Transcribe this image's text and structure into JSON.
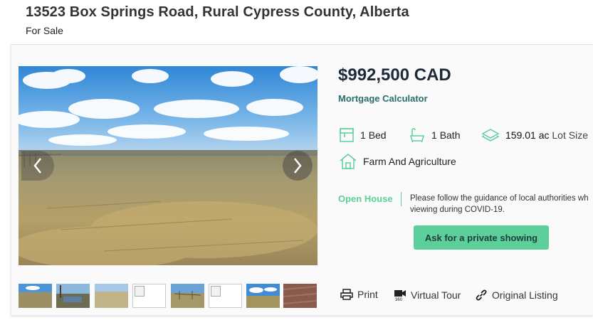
{
  "listing": {
    "address": "13523 Box Springs Road, Rural Cypress County, Alberta",
    "status": "For Sale",
    "price": "$992,500 CAD",
    "mortgage_link": "Mortgage Calculator"
  },
  "features": {
    "bed": {
      "value": "1",
      "label": "Bed",
      "icon": "bed-icon"
    },
    "bath": {
      "value": "1",
      "label": "Bath",
      "icon": "bathtub-icon"
    },
    "lot": {
      "value": "159.01 ac",
      "label": "Lot Size",
      "icon": "lot-size-icon"
    },
    "type": {
      "label": "Farm And Agriculture",
      "icon": "house-icon"
    }
  },
  "open_house": {
    "label": "Open House",
    "line1": "Please follow the guidance of local authorities wh",
    "line2": "viewing during COVID-19."
  },
  "cta": {
    "label": "Ask for a private showing"
  },
  "actions": {
    "print": "Print",
    "virtual_tour": "Virtual Tour",
    "original_listing": "Original Listing"
  },
  "gallery": {
    "thumbnails": [
      "prairie",
      "pond",
      "field",
      "broken",
      "fence",
      "broken",
      "prairie-sky",
      "brick"
    ]
  },
  "colors": {
    "accent_green": "#5dcf9a",
    "link_teal": "#2b6e6b",
    "price_navy": "#1d2a3a",
    "icon_green": "#5dcf9a"
  }
}
